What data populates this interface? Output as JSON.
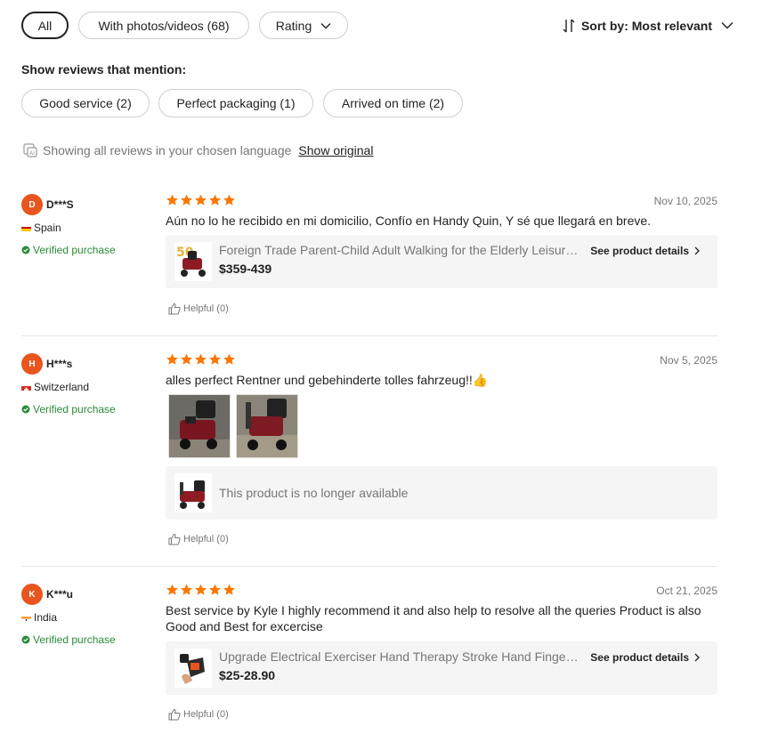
{
  "filters": {
    "all": "All",
    "with_media": "With photos/videos (68)",
    "rating": "Rating",
    "sort_prefix": "Sort by: ",
    "sort_value": "Most relevant"
  },
  "mentions": {
    "title": "Show reviews that mention:",
    "tags": [
      "Good service (2)",
      "Perfect packaging (1)",
      "Arrived on time (2)"
    ]
  },
  "language": {
    "notice": "Showing all reviews in your chosen language",
    "show_original": "Show original"
  },
  "reviews": [
    {
      "initial": "D",
      "name": "D***S",
      "country": "Spain",
      "verified": "Verified purchase",
      "rating": 5,
      "date": "Nov 10, 2025",
      "text": "Aún no lo he recibido en mi domicilio, Confío en Handy Quin, Y sé que llegará en breve.",
      "product": {
        "title": "Foreign Trade Parent-Child Adult Walking for the Elderly Leisure Four-Wheel Scooter",
        "price": "$359-439",
        "details": "See product details"
      },
      "helpful": "Helpful (0)"
    },
    {
      "initial": "H",
      "name": "H***s",
      "country": "Switzerland",
      "verified": "Verified purchase",
      "rating": 5,
      "date": "Nov 5, 2025",
      "text": "alles perfect Rentner und gebehinderte tolles fahrzeug!!👍",
      "product": {
        "unavailable": "This product is no longer available"
      },
      "helpful": "Helpful (0)"
    },
    {
      "initial": "K",
      "name": "K***u",
      "country": "India",
      "verified": "Verified purchase",
      "rating": 5,
      "date": "Oct 21, 2025",
      "text": "Best service by Kyle I highly recommend it and also help to resolve all the queries Product is also Good and Best for excercise",
      "product": {
        "title": "Upgrade Electrical Exerciser Hand Therapy Stroke Hand Finger Rehabilitation Glove",
        "price": "$25-28.90",
        "details": "See product details"
      },
      "helpful": "Helpful (0)"
    }
  ],
  "colors": {
    "star": "#fb7701",
    "avatar": "#e8551e",
    "verified": "#2a8a3a"
  }
}
